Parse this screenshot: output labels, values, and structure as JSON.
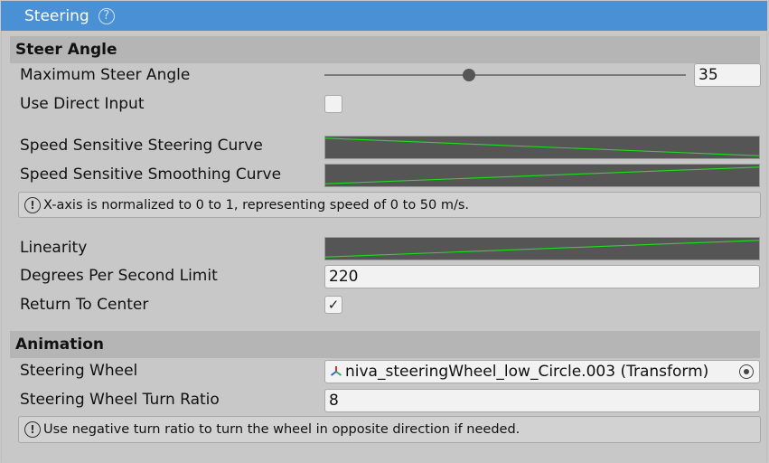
{
  "header": {
    "title": "Steering",
    "help_glyph": "?"
  },
  "sections": {
    "steer_angle": "Steer Angle",
    "animation": "Animation"
  },
  "fields": {
    "max_steer_angle": {
      "label": "Maximum Steer Angle",
      "value": "35",
      "slider_fraction": 0.4
    },
    "use_direct_input": {
      "label": "Use Direct Input",
      "checked": false
    },
    "speed_steering_curve": {
      "label": "Speed Sensitive Steering Curve"
    },
    "speed_smoothing_curve": {
      "label": "Speed Sensitive Smoothing Curve"
    },
    "speed_help": "X-axis is normalized to 0 to 1, representing speed of 0 to 50 m/s.",
    "linearity": {
      "label": "Linearity"
    },
    "degrees_per_second": {
      "label": "Degrees Per Second Limit",
      "value": "220"
    },
    "return_to_center": {
      "label": "Return To Center",
      "checked": true,
      "check_glyph": "✓"
    },
    "steering_wheel": {
      "label": "Steering Wheel",
      "value": "niva_steeringWheel_low_Circle.003 (Transform)"
    },
    "turn_ratio": {
      "label": "Steering Wheel Turn Ratio",
      "value": "8"
    },
    "turn_ratio_help": "Use negative turn ratio to turn the wheel in opposite direction if needed."
  },
  "colors": {
    "accent": "#4a90d4",
    "curve_line": "#22dd22",
    "curve_bg": "#555555"
  },
  "icons": {
    "help": "help-icon",
    "info": "info-icon",
    "transform": "transform-icon",
    "picker": "object-picker-icon"
  }
}
